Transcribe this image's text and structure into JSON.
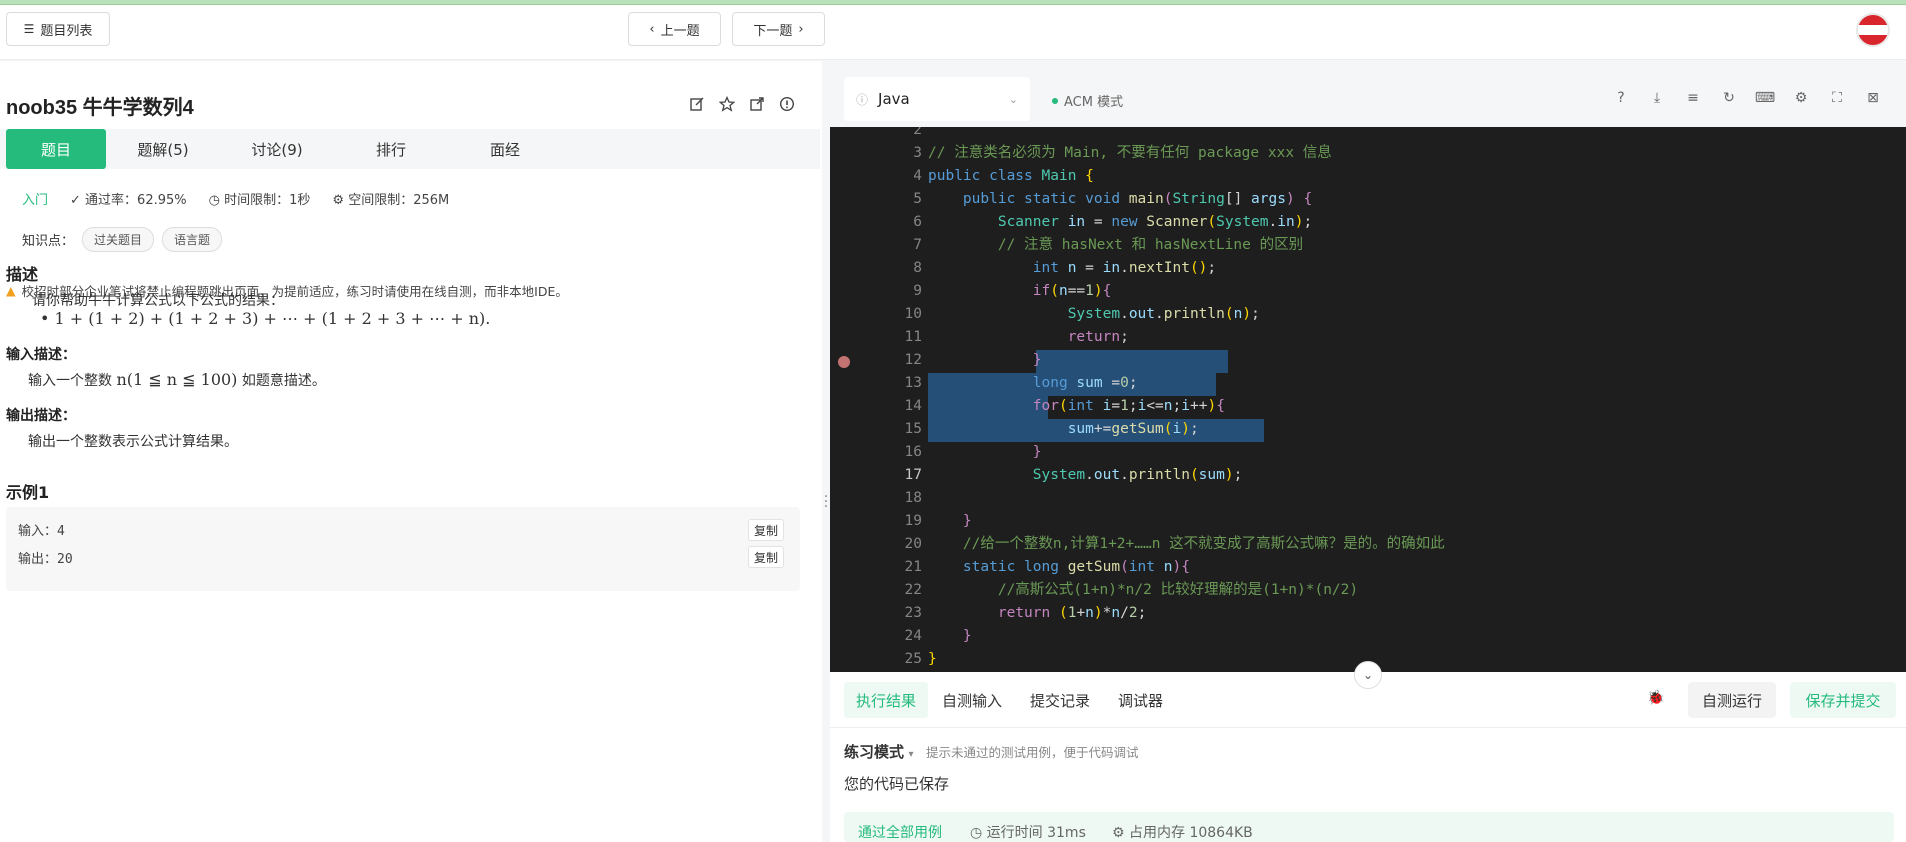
{
  "topbar": {
    "problem_list_label": "题目列表",
    "prev_label": "上一题",
    "next_label": "下一题"
  },
  "problem": {
    "title": "noob35  牛牛学数列4",
    "tabs": [
      "题目",
      "题解(5)",
      "讨论(9)",
      "排行",
      "面经"
    ],
    "level": "入门",
    "pass_rate": "通过率：62.95%",
    "time_limit": "时间限制：1秒",
    "space_limit": "空间限制：256M",
    "knowledge_label": "知识点：",
    "tags": [
      "过关题目",
      "语言题"
    ],
    "warning": "校招时部分企业笔试将禁止编程题跳出页面，为提前适应，练习时请使用在线自测，而非本地IDE。",
    "desc_heading": "描述",
    "desc_text": "请你帮助牛牛计算公式以下公式的结果：",
    "formula": "1 + (1 + 2) + (1 + 2 + 3) + ⋯ + (1 + 2 + 3 + ⋯ + n).",
    "input_heading": "输入描述：",
    "input_text_pre": "输入一个整数 ",
    "input_math": "n(1 ≦ n ≦ 100)",
    "input_text_post": " 如题意描述。",
    "output_heading": "输出描述：",
    "output_text": "输出一个整数表示公式计算结果。",
    "example_heading": "示例1",
    "example_input": "输入：4",
    "example_output": "输出：20",
    "copy_label": "复制"
  },
  "editor": {
    "language": "Java",
    "mode": "ACM 模式",
    "line_numbers": [
      "2",
      "3",
      "4",
      "5",
      "6",
      "7",
      "8",
      "9",
      "10",
      "11",
      "12",
      "13",
      "14",
      "15",
      "16",
      "17",
      "18",
      "19",
      "20",
      "21",
      "22",
      "23",
      "24",
      "25"
    ],
    "current_line": "17",
    "breakpoint_line": "14"
  },
  "results": {
    "tabs": [
      "执行结果",
      "自测输入",
      "提交记录",
      "调试器"
    ],
    "self_test_label": "自测运行",
    "submit_label": "保存并提交",
    "practice_mode": "练习模式",
    "practice_hint": "提示未通过的测试用例，便于代码调试",
    "saved_text": "您的代码已保存",
    "pass_text": "通过全部用例",
    "run_time": "运行时间 31ms",
    "memory": "占用内存 10864KB"
  },
  "colors": {
    "accent": "#25bb7d",
    "editor_bg": "#1e1e1e",
    "selection": "#264f78"
  }
}
